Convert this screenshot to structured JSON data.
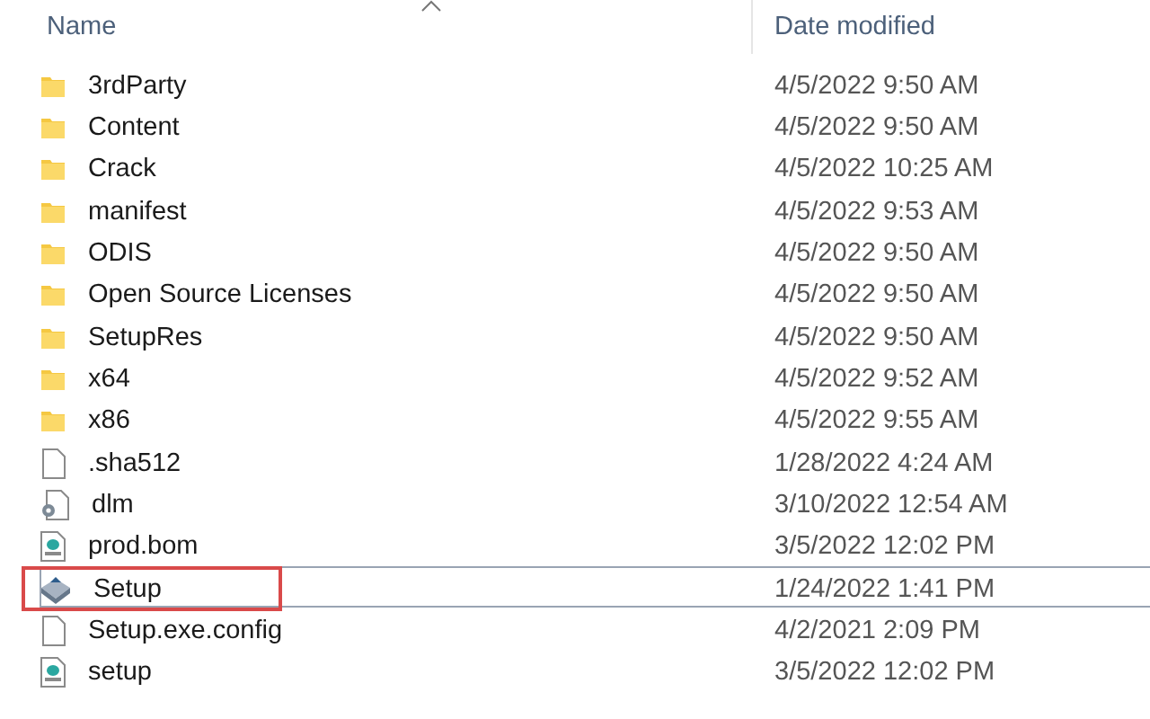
{
  "columns": [
    {
      "label": "Name",
      "sorted": true
    },
    {
      "label": "Date modified",
      "sorted": false
    }
  ],
  "rows": [
    {
      "kind": "folder",
      "name": "3rdParty",
      "date": "4/5/2022 9:50 AM",
      "selected": false,
      "highlighted": false
    },
    {
      "kind": "folder",
      "name": "Content",
      "date": "4/5/2022 9:50 AM",
      "selected": false,
      "highlighted": false
    },
    {
      "kind": "folder",
      "name": "Crack",
      "date": "4/5/2022 10:25 AM",
      "selected": false,
      "highlighted": false
    },
    {
      "kind": "folder",
      "name": "manifest",
      "date": "4/5/2022 9:53 AM",
      "selected": false,
      "highlighted": false
    },
    {
      "kind": "folder",
      "name": "ODIS",
      "date": "4/5/2022 9:50 AM",
      "selected": false,
      "highlighted": false
    },
    {
      "kind": "folder",
      "name": "Open Source Licenses",
      "date": "4/5/2022 9:50 AM",
      "selected": false,
      "highlighted": false
    },
    {
      "kind": "folder",
      "name": "SetupRes",
      "date": "4/5/2022 9:50 AM",
      "selected": false,
      "highlighted": false
    },
    {
      "kind": "folder",
      "name": "x64",
      "date": "4/5/2022 9:52 AM",
      "selected": false,
      "highlighted": false
    },
    {
      "kind": "folder",
      "name": "x86",
      "date": "4/5/2022 9:55 AM",
      "selected": false,
      "highlighted": false
    },
    {
      "kind": "file",
      "name": ".sha512",
      "date": "1/28/2022 4:24 AM",
      "selected": false,
      "highlighted": false
    },
    {
      "kind": "settings",
      "name": "dlm",
      "date": "3/10/2022 12:54 AM",
      "selected": false,
      "highlighted": false
    },
    {
      "kind": "config",
      "name": "prod.bom",
      "date": "3/5/2022 12:02 PM",
      "selected": false,
      "highlighted": false
    },
    {
      "kind": "installer",
      "name": "Setup",
      "date": "1/24/2022 1:41 PM",
      "selected": true,
      "highlighted": true
    },
    {
      "kind": "file",
      "name": "Setup.exe.config",
      "date": "4/2/2021 2:09 PM",
      "selected": false,
      "highlighted": false
    },
    {
      "kind": "config",
      "name": "setup",
      "date": "3/5/2022 12:02 PM",
      "selected": false,
      "highlighted": false
    }
  ]
}
